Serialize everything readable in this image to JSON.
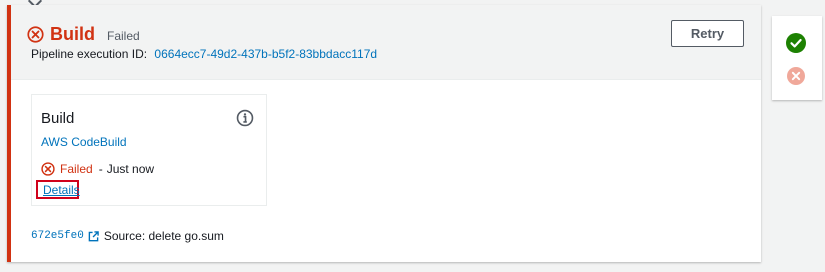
{
  "stage": {
    "name": "Build",
    "status": "Failed",
    "execution_label": "Pipeline execution ID:",
    "execution_id": "0664ecc7-49d2-437b-b5f2-83bbdacc117d",
    "retry_label": "Retry"
  },
  "action": {
    "name": "Build",
    "provider": "AWS CodeBuild",
    "status": "Failed",
    "separator": "-",
    "time": "Just now",
    "details_label": "Details"
  },
  "source": {
    "commit_id": "672e5fe0",
    "message": "Source: delete go.sum"
  },
  "side_panel": {
    "items": [
      {
        "state": "succeeded",
        "icon": "check-circle-icon",
        "color": "#1d8102"
      },
      {
        "state": "failed",
        "icon": "x-circle-icon",
        "color": "#f0a89a"
      }
    ]
  },
  "colors": {
    "error": "#d13212",
    "link": "#0073bb",
    "success": "#1d8102",
    "highlight": "#d0021b"
  }
}
